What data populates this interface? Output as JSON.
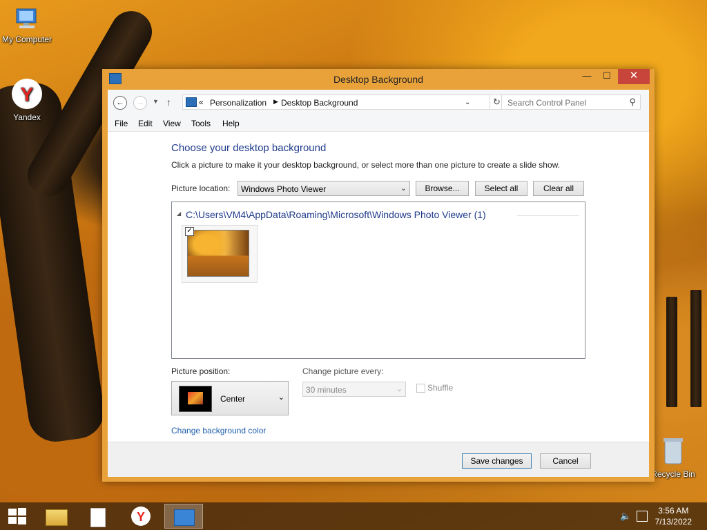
{
  "desktop": {
    "icons": [
      {
        "label": "My Computer"
      },
      {
        "label": "Yandex"
      },
      {
        "label": "Recycle Bin"
      }
    ]
  },
  "window": {
    "title": "Desktop Background",
    "controls": {
      "minimize": "—",
      "maximize": "☐",
      "close": "✕"
    }
  },
  "nav": {
    "breadcrumb_prefix": "«",
    "breadcrumb": [
      "Personalization",
      "Desktop Background"
    ],
    "search_placeholder": "Search Control Panel"
  },
  "menu": [
    "File",
    "Edit",
    "View",
    "Tools",
    "Help"
  ],
  "content": {
    "heading": "Choose your desktop background",
    "description": "Click a picture to make it your desktop background, or select more than one picture to create a slide show.",
    "picture_location_label": "Picture location:",
    "picture_location_value": "Windows Photo Viewer",
    "browse": "Browse...",
    "select_all": "Select all",
    "clear_all": "Clear all",
    "group_header": "C:\\Users\\VM4\\AppData\\Roaming\\Microsoft\\Windows Photo Viewer (1)",
    "thumbnail_checked": true,
    "picture_position_label": "Picture position:",
    "picture_position_value": "Center",
    "change_every_label": "Change picture every:",
    "change_every_value": "30 minutes",
    "shuffle_label": "Shuffle",
    "change_color_link": "Change background color"
  },
  "footer": {
    "save": "Save changes",
    "cancel": "Cancel"
  },
  "taskbar": {
    "time": "3:56 AM",
    "date": "7/13/2022"
  },
  "colors": {
    "window_frame": "#e9a23a",
    "close_button": "#c7453a",
    "heading": "#1e3a8a",
    "link": "#1e5eaa"
  }
}
